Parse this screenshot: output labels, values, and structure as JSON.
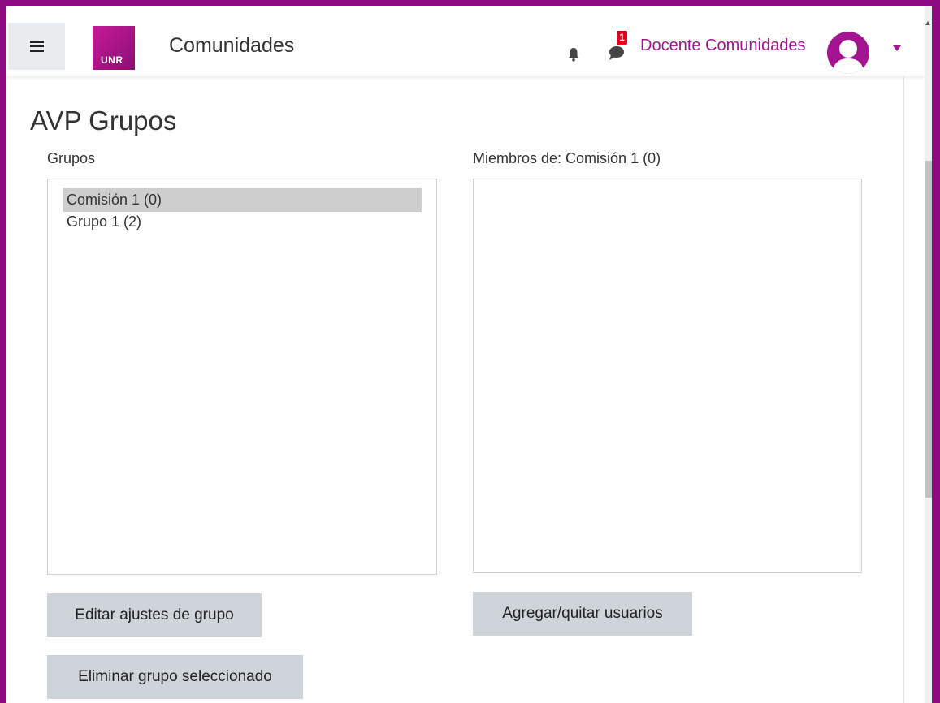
{
  "navbar": {
    "menu_icon": "hamburger-icon",
    "logo_text": "UNR",
    "site_name": "Comunidades",
    "notifications_icon": "bell-icon",
    "messages_icon": "chat-icon",
    "messages_badge": "1",
    "user_name": "Docente Comunidades",
    "avatar_icon": "user-avatar-icon",
    "dropdown_icon": "caret-down-icon"
  },
  "colors": {
    "brand": "#a31590",
    "frame": "#8e0a80",
    "badge": "#e3001b",
    "button_bg": "#ced4da",
    "selected_bg": "#cecece"
  },
  "page": {
    "title": "AVP Grupos"
  },
  "groups": {
    "label": "Grupos",
    "items": [
      {
        "label": "Comisión 1 (0)",
        "selected": true
      },
      {
        "label": "Grupo 1 (2)",
        "selected": false
      }
    ]
  },
  "members": {
    "label": "Miembros de: Comisión 1 (0)",
    "items": []
  },
  "buttons": {
    "edit_group": "Editar ajustes de grupo",
    "add_remove_users": "Agregar/quitar usuarios",
    "delete_group": "Eliminar grupo seleccionado"
  }
}
